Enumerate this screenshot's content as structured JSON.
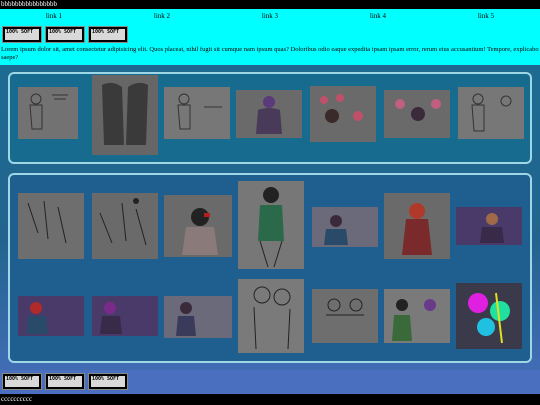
{
  "top_bar": {
    "text": "bbbbbbbbbbbbbbbb"
  },
  "nav": {
    "links": [
      "link 1",
      "link 2",
      "link 3",
      "link 4",
      "link 5"
    ]
  },
  "badge_label": "100% SOFT",
  "intro_text": "Lorem ipsum dolor sit, amet consectetur adipisicing elit. Quos placeat, nihil fugit sit cumque nam ipsum quas? Doloribus odio eaque expedita ipsam ipsam error, rerum eius accusantium! Tempore, explicabo saepe?",
  "gallery_1": {
    "count": 7
  },
  "gallery_2": {
    "count": 14
  },
  "footer": {
    "text": "cccccccccc"
  },
  "colors": {
    "nav_bg": "#00ffff",
    "panel_border": "#9fd6e6",
    "panel_bg": "#176b8e",
    "thumb_bg": "#6e6e6e"
  }
}
